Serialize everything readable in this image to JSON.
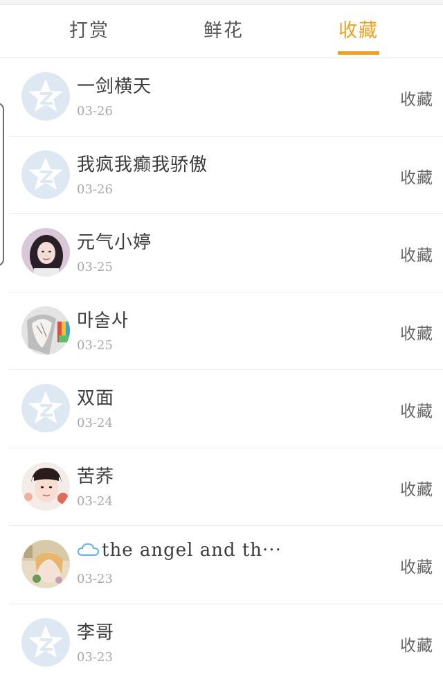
{
  "tabs": [
    {
      "label": "打赏",
      "active": false
    },
    {
      "label": "鲜花",
      "active": false
    },
    {
      "label": "收藏",
      "active": true
    }
  ],
  "colors": {
    "accent": "#f0a01c",
    "text": "#3c3c3c",
    "muted": "#a8a8a8",
    "divider": "#e6e6e6",
    "default_avatar_bg": "#dde8f3"
  },
  "rows": [
    {
      "name": "一剑横天",
      "date": "03-26",
      "action": "收藏",
      "avatar": "default-qzone-icon"
    },
    {
      "name": "我疯我癫我骄傲",
      "date": "03-26",
      "action": "收藏",
      "avatar": "default-qzone-icon"
    },
    {
      "name": "元气小婷",
      "date": "03-25",
      "action": "收藏",
      "avatar": "user-photo"
    },
    {
      "name": "마술사",
      "date": "03-25",
      "action": "收藏",
      "avatar": "user-photo"
    },
    {
      "name": "双面",
      "date": "03-24",
      "action": "收藏",
      "avatar": "default-qzone-icon"
    },
    {
      "name": "苦荞",
      "date": "03-24",
      "action": "收藏",
      "avatar": "user-photo"
    },
    {
      "name": "the angel and th···",
      "name_icon": "cloud-icon",
      "date": "03-23",
      "action": "收藏",
      "avatar": "user-photo"
    },
    {
      "name": "李哥",
      "date": "03-23",
      "action": "收藏",
      "avatar": "default-qzone-icon"
    }
  ]
}
